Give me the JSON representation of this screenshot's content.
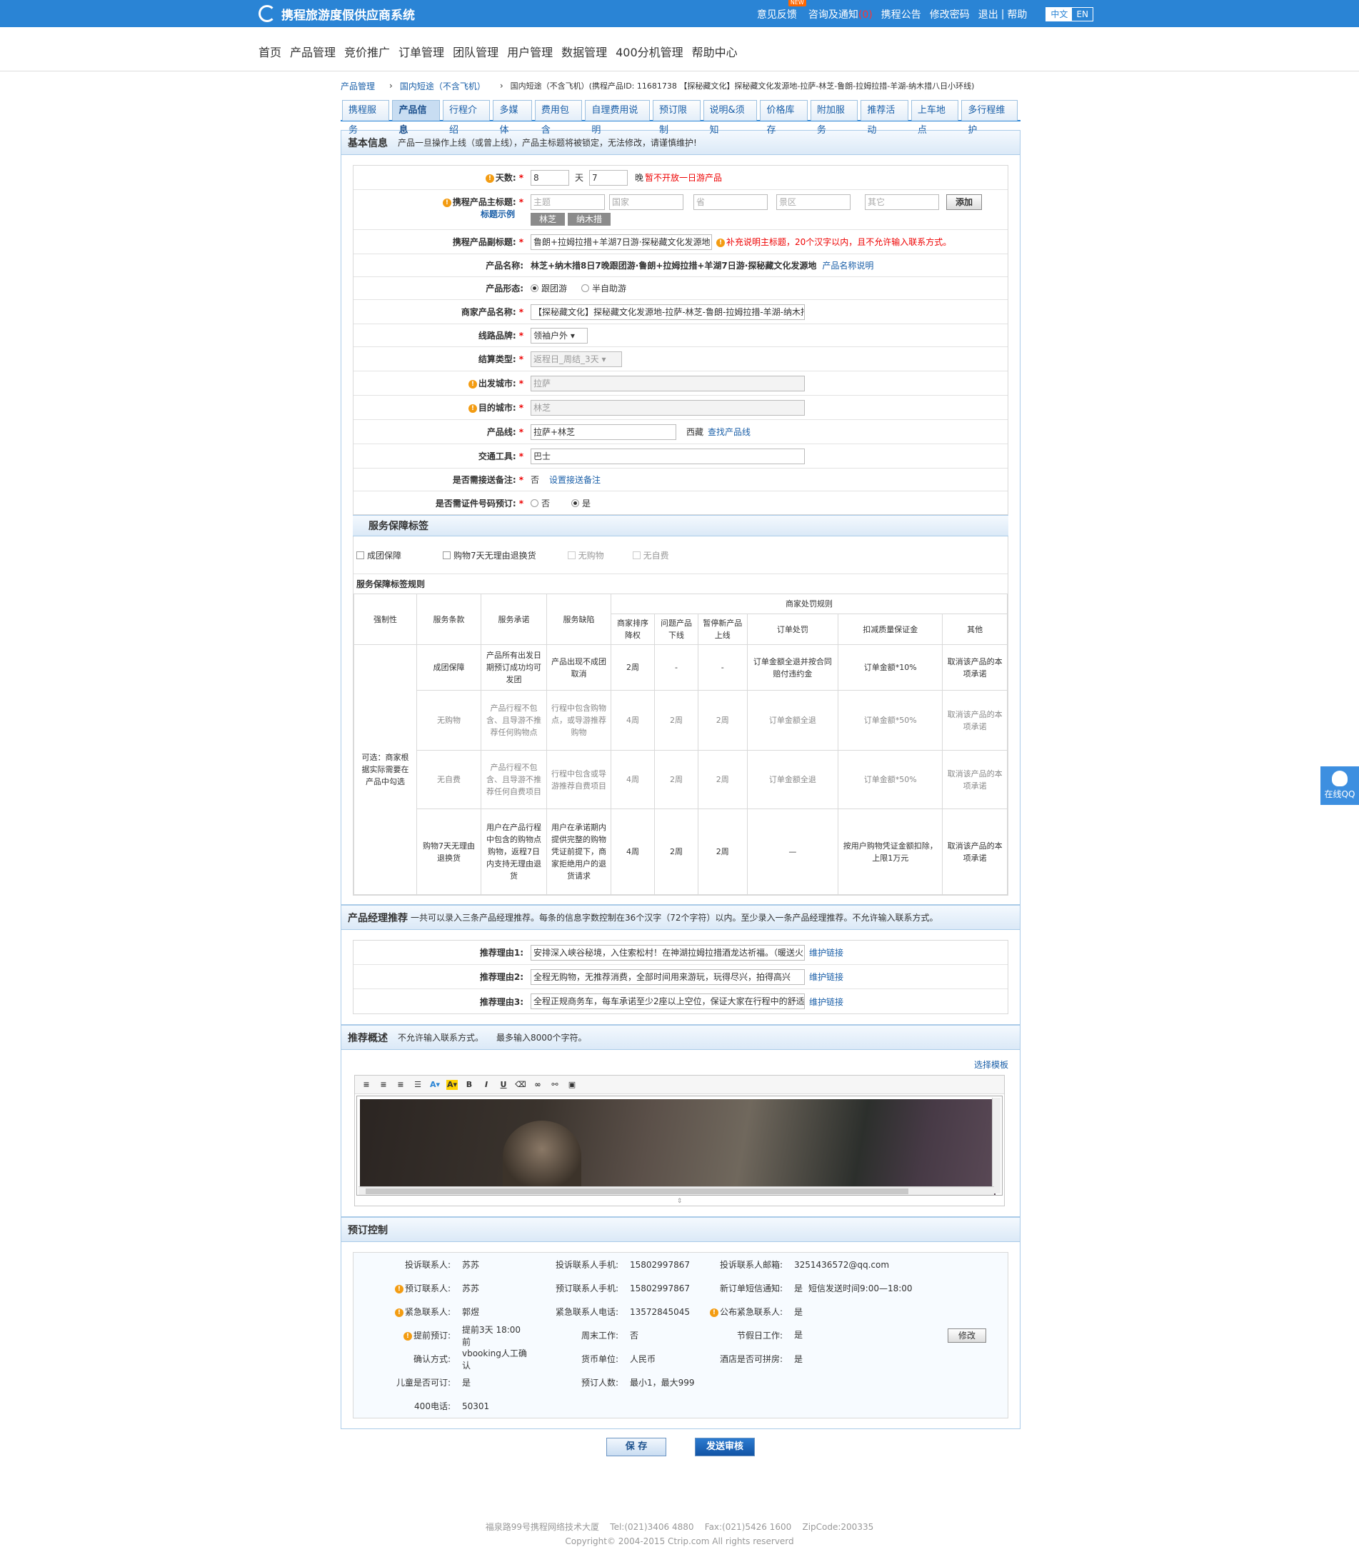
{
  "header": {
    "title": "携程旅游度假供应商系统",
    "links": {
      "feedback": "意见反馈",
      "new_badge": "NEW",
      "consult": "咨询及通知",
      "consult_count": "(0)",
      "notice": "携程公告",
      "change_pwd": "修改密码",
      "logout": "退出",
      "help": "帮助"
    },
    "lang": {
      "zh": "中文",
      "en": "EN"
    }
  },
  "nav": [
    "首页",
    "产品管理",
    "竞价推广",
    "订单管理",
    "团队管理",
    "用户管理",
    "数据管理",
    "400分机管理",
    "帮助中心"
  ],
  "breadcrumb": {
    "a": "产品管理",
    "b": "国内短途（不含飞机）",
    "c": "国内短途（不含飞机）(携程产品ID: 11681738 【探秘藏文化】探秘藏文化发源地-拉萨-林芝-鲁朗-拉姆拉措-羊湖-纳木措八日小环线)"
  },
  "tabs": [
    "携程服务",
    "产品信息",
    "行程介绍",
    "多媒体",
    "费用包含",
    "自理费用说明",
    "预订限制",
    "说明&须知",
    "价格库存",
    "附加服务",
    "推荐活动",
    "上车地点",
    "多行程维护"
  ],
  "basic": {
    "title": "基本信息",
    "note": "产品一旦操作上线（或曾上线），产品主标题将被锁定，无法修改，请谨慎维护!",
    "days_label": "天数:",
    "days": "8",
    "day_unit": "天",
    "nights": "7",
    "night_unit": "晚",
    "days_tip": "暂不开放一日游产品",
    "maintitle_label": "携程产品主标题:",
    "title_example": "标题示例",
    "ph_theme": "主题",
    "ph_country": "国家",
    "ph_province": "省",
    "ph_scenic": "景区",
    "ph_other": "其它",
    "add_btn": "添加",
    "chips": [
      "林芝",
      "纳木措"
    ],
    "subtitle_label": "携程产品副标题:",
    "subtitle": "鲁朗+拉姆拉措+羊湖7日游·探秘藏文化发源地",
    "subtitle_tip": "补充说明主标题，20个汉字以内，且不允许输入联系方式。",
    "name_label": "产品名称:",
    "name": "林芝+纳木措8日7晚跟团游·鲁朗+拉姆拉措+羊湖7日游·探秘藏文化发源地",
    "name_help": "产品名称说明",
    "form_label": "产品形态:",
    "form_opt1": "跟团游",
    "form_opt2": "半自助游",
    "merchant_label": "商家产品名称:",
    "merchant": "【探秘藏文化】探秘藏文化发源地-拉萨-林芝-鲁朗-拉姆拉措-羊湖-纳木措",
    "brand_label": "线路品牌:",
    "brand": "领袖户外",
    "settle_label": "结算类型:",
    "settle": "返程日_周结_3天",
    "dep_label": "出发城市:",
    "dep": "拉萨",
    "dest_label": "目的城市:",
    "dest": "林芝",
    "line_label": "产品线:",
    "line": "拉萨+林芝",
    "line_region": "西藏",
    "line_find": "查找产品线",
    "traffic_label": "交通工具:",
    "traffic": "巴士",
    "transfer_label": "是否需接送备注:",
    "transfer": "否",
    "transfer_link": "设置接送备注",
    "id_label": "是否需证件号码预订:",
    "id_no": "否",
    "id_yes": "是"
  },
  "service": {
    "title": "服务保障标签",
    "options": [
      "成团保障",
      "购物7天无理由退换货",
      "无购物",
      "无自费"
    ],
    "rules_title": "服务保障标签规则",
    "headers": [
      "强制性",
      "服务条款",
      "服务承诺",
      "服务缺陷",
      "商家处罚规则",
      "商家排序降权",
      "问题产品下线",
      "暂停新产品上线",
      "订单处罚",
      "扣减质量保证金",
      "其他"
    ],
    "optional_note": "可选：商家根据实际需要在产品中勾选",
    "rows": [
      [
        "成团保障",
        "产品所有出发日期预订成功均可发团",
        "产品出现不成团取消",
        "2周",
        "-",
        "-",
        "订单金额全退并按合同赔付违约金",
        "订单金额*10%",
        "取消该产品的本项承诺"
      ],
      [
        "无购物",
        "产品行程不包含、且导游不推荐任何购物点",
        "行程中包含购物点，或导游推荐购物",
        "4周",
        "2周",
        "2周",
        "订单金额全退",
        "订单金额*50%",
        "取消该产品的本项承诺"
      ],
      [
        "无自费",
        "产品行程不包含、且导游不推荐任何自费项目",
        "行程中包含或导游推荐自费项目",
        "4周",
        "2周",
        "2周",
        "订单金额全退",
        "订单金额*50%",
        "取消该产品的本项承诺"
      ],
      [
        "购物7天无理由退换货",
        "用户在产品行程中包含的购物点购物，返程7日内支持无理由退货",
        "用户在承诺期内提供完整的购物凭证前提下，商家拒绝用户的退货请求",
        "4周",
        "2周",
        "2周",
        "—",
        "按用户购物凭证金额扣除，上限1万元",
        "取消该产品的本项承诺"
      ]
    ]
  },
  "manager": {
    "title": "产品经理推荐",
    "note": "一共可以录入三条产品经理推荐。每条的信息字数控制在36个汉字（72个字符）以内。至少录入一条产品经理推荐。不允许输入联系方式。",
    "items": [
      {
        "label": "推荐理由1:",
        "value": "安排深入峡谷秘境，入住索松村！在神湖拉姆拉措酒龙达祈福。（暖送火"
      },
      {
        "label": "推荐理由2:",
        "value": "全程无购物，无推荐消费，全部时间用来游玩，玩得尽兴，拍得高兴"
      },
      {
        "label": "推荐理由3:",
        "value": "全程正规商务车，每车承诺至少2座以上空位，保证大家在行程中的舒适"
      }
    ],
    "link": "维护链接"
  },
  "overview": {
    "title": "推荐概述",
    "note1": "不允许输入联系方式。",
    "note2": "最多输入8000个字符。",
    "template_link": "选择模板"
  },
  "booking": {
    "title": "预订控制",
    "complain_contact_label": "投诉联系人:",
    "complain_contact": "苏苏",
    "complain_phone_label": "投诉联系人手机:",
    "complain_phone": "15802997867",
    "complain_email_label": "投诉联系人邮箱:",
    "complain_email": "3251436572@qq.com",
    "book_contact_label": "预订联系人:",
    "book_contact": "苏苏",
    "book_phone_label": "预订联系人手机:",
    "book_phone": "15802997867",
    "sms_label": "新订单短信通知:",
    "sms": "是",
    "sms_time": "短信发送时间9:00—18:00",
    "urgent_contact_label": "紧急联系人:",
    "urgent_contact": "郭煜",
    "urgent_phone_label": "紧急联系人电话:",
    "urgent_phone": "13572845045",
    "publish_label": "公布紧急联系人:",
    "publish": "是",
    "advance_label": "提前预订:",
    "advance": "提前3天 18:00 前",
    "weekend_label": "周末工作:",
    "weekend": "否",
    "holiday_label": "节假日工作:",
    "holiday": "是",
    "modify_btn": "修改",
    "confirm_label": "确认方式:",
    "confirm": "vbooking人工确认",
    "currency_label": "货币单位:",
    "currency": "人民币",
    "hotel_label": "酒店是否可拼房:",
    "hotel": "是",
    "child_label": "儿童是否可订:",
    "child": "是",
    "people_label": "预订人数:",
    "people": "最小1，最大999",
    "tel_label": "400电话:",
    "tel": "50301"
  },
  "actions": {
    "save": "保 存",
    "submit": "发送审核"
  },
  "footer": {
    "line1": "福泉路99号携程网络技术大厦    Tel:(021)3406 4880    Fax:(021)5426 1600    ZipCode:200335",
    "line2": "Copyright© 2004-2015 Ctrip.com All rights reserverd"
  },
  "qq": "在线QQ"
}
